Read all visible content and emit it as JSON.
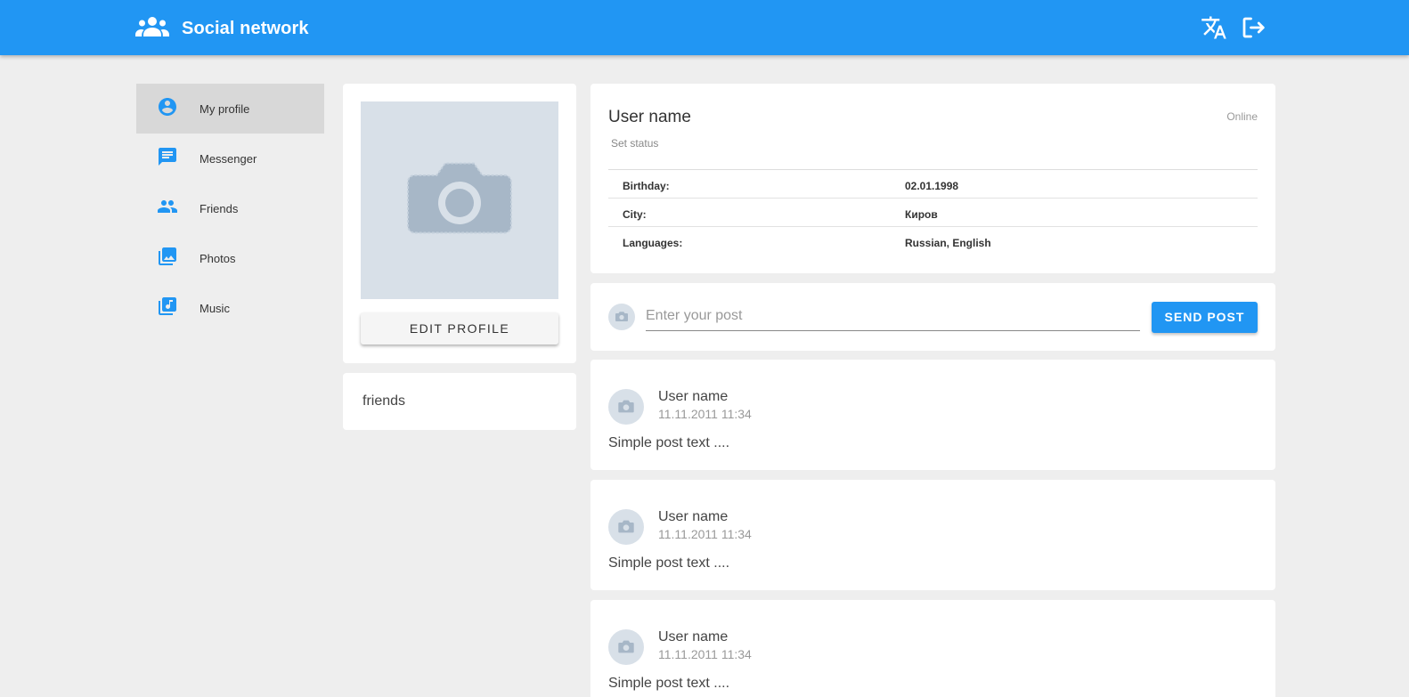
{
  "header": {
    "title": "Social network",
    "logo_icon": "people-icon",
    "actions": [
      {
        "icon": "translate-icon"
      },
      {
        "icon": "logout-icon"
      }
    ]
  },
  "colors": {
    "primary": "#2196f3",
    "background": "#eeeeee",
    "active_nav": "#d8d8d8"
  },
  "sidebar": {
    "items": [
      {
        "label": "My profile",
        "icon": "account-circle-icon",
        "active": true
      },
      {
        "label": "Messenger",
        "icon": "message-icon",
        "active": false
      },
      {
        "label": "Friends",
        "icon": "friends-icon",
        "active": false
      },
      {
        "label": "Photos",
        "icon": "photos-icon",
        "active": false
      },
      {
        "label": "Music",
        "icon": "music-library-icon",
        "active": false
      }
    ]
  },
  "profile": {
    "edit_label": "EDIT PROFILE",
    "friends_label": "friends",
    "name": "User name",
    "status_placeholder": "Set status",
    "online": "Online",
    "info": [
      {
        "key": "Birthday:",
        "value": "02.01.1998"
      },
      {
        "key": "City:",
        "value": "Киров"
      },
      {
        "key": "Languages:",
        "value": "Russian, English"
      }
    ]
  },
  "composer": {
    "placeholder": "Enter your post",
    "value": "",
    "send_label": "SEND POST"
  },
  "posts": [
    {
      "author": "User name",
      "date": "11.11.2011 11:34",
      "text": "Simple post text ...."
    },
    {
      "author": "User name",
      "date": "11.11.2011 11:34",
      "text": "Simple post text ...."
    },
    {
      "author": "User name",
      "date": "11.11.2011 11:34",
      "text": "Simple post text ...."
    }
  ]
}
